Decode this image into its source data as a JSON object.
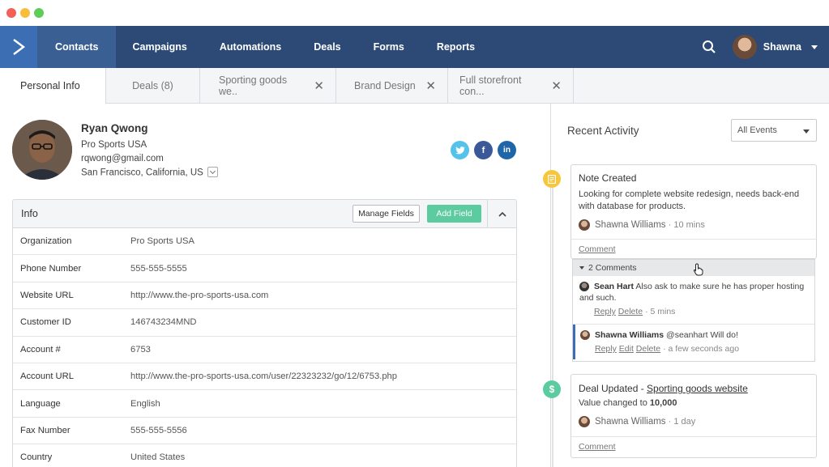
{
  "nav": {
    "items": [
      {
        "label": "Contacts",
        "active": true
      },
      {
        "label": "Campaigns"
      },
      {
        "label": "Automations"
      },
      {
        "label": "Deals"
      },
      {
        "label": "Forms"
      },
      {
        "label": "Reports"
      }
    ],
    "user_name": "Shawna"
  },
  "tabs": [
    {
      "label": "Personal Info",
      "active": true,
      "closable": false
    },
    {
      "label": "Deals (8)",
      "closable": false
    },
    {
      "label": "Sporting goods we..",
      "closable": true
    },
    {
      "label": "Brand Design",
      "closable": true
    },
    {
      "label": "Full storefront con...",
      "closable": true
    }
  ],
  "contact": {
    "name": "Ryan Qwong",
    "company": "Pro Sports USA",
    "email": "rqwong@gmail.com",
    "location": "San Francisco, California, US",
    "social": [
      {
        "icon": "twitter-icon",
        "glyph": "t",
        "color": "#55c2ea"
      },
      {
        "icon": "facebook-icon",
        "glyph": "f",
        "color": "#3b5998"
      },
      {
        "icon": "linkedin-icon",
        "glyph": "in",
        "color": "#1f66a8"
      }
    ]
  },
  "info": {
    "title": "Info",
    "manage_label": "Manage Fields",
    "add_label": "Add Field",
    "rows": [
      {
        "label": "Organization",
        "value": "Pro Sports USA"
      },
      {
        "label": "Phone Number",
        "value": "555-555-5555"
      },
      {
        "label": "Website URL",
        "value": "http://www.the-pro-sports-usa.com"
      },
      {
        "label": "Customer ID",
        "value": "146743234MND"
      },
      {
        "label": "Account #",
        "value": "6753"
      },
      {
        "label": "Account URL",
        "value": "http://www.the-pro-sports-usa.com/user/22323232/go/12/6753.php"
      },
      {
        "label": "Language",
        "value": "English"
      },
      {
        "label": "Fax Number",
        "value": "555-555-5556"
      },
      {
        "label": "Country",
        "value": "United States"
      }
    ]
  },
  "activity": {
    "title": "Recent Activity",
    "filter_value": "All Events",
    "note": {
      "title": "Note Created",
      "body": "Looking for complete website redesign, needs back-end with database for products.",
      "author": "Shawna Williams",
      "time": "· 10 mins",
      "comment_link": "Comment",
      "icon_color": "#f7c63f",
      "comments_toggle": "2 Comments",
      "comments": [
        {
          "name": "Sean Hart",
          "text": "Also ask to make sure he has proper hosting and such.",
          "actions": [
            "Reply",
            "Delete"
          ],
          "time": "· 5 mins"
        },
        {
          "name": "Shawna Williams",
          "text": "@seanhart Will do!",
          "actions": [
            "Reply",
            "Edit",
            "Delete"
          ],
          "time": "· a few seconds ago"
        }
      ]
    },
    "deal": {
      "title_prefix": "Deal Updated - ",
      "title_link": "Sporting goods website",
      "body_prefix": "Value changed to ",
      "body_value": "10,000",
      "author": "Shawna Williams",
      "time": "· 1 day",
      "comment_link": "Comment",
      "icon_glyph": "$",
      "icon_color": "#5ccba0"
    }
  },
  "colors": {
    "nav_bg": "#2c4a75",
    "nav_active": "#3a5f93",
    "accent_green": "#5ccba0",
    "accent_blue": "#3c6eb4"
  }
}
